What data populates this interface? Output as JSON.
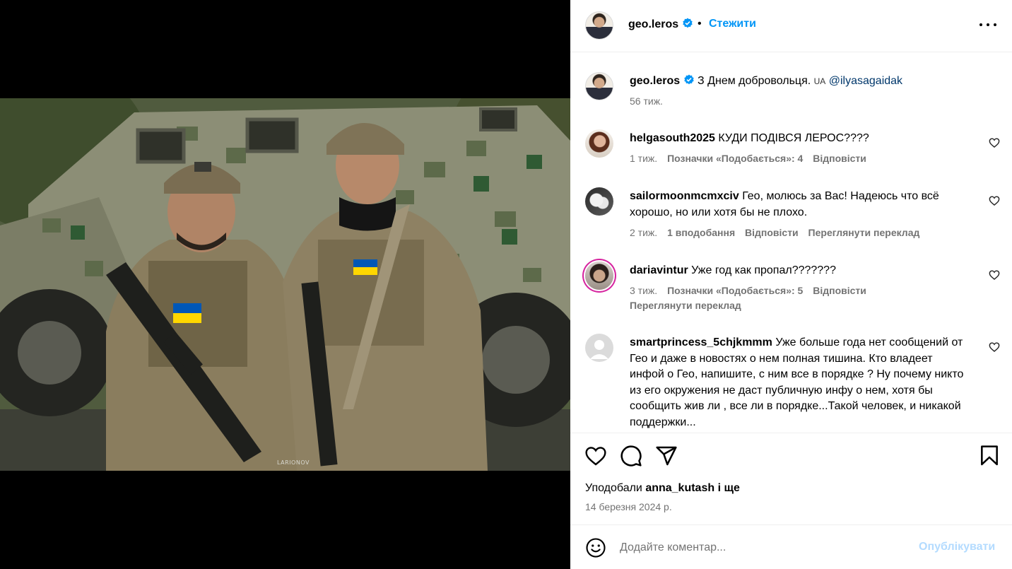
{
  "post": {
    "author": "geo.leros",
    "follow_label": "Стежити",
    "separator": "•",
    "caption_text": "З Днем добровольця. ",
    "caption_flag": "UA",
    "caption_mention": "@ilyasagaidak",
    "caption_time": "56 тиж.",
    "image_watermark": "LARIONOV"
  },
  "comments": [
    {
      "user": "helgasouth2025",
      "text": "КУДИ ПОДІВСЯ ЛЕРОС????",
      "time": "1 тиж.",
      "likes": "Позначки «Подобається»: 4",
      "reply": "Відповісти",
      "translate": ""
    },
    {
      "user": "sailormoonmcmxciv",
      "text": "Гео, молюсь за Вас! Надеюсь что всё хорошо, но или хотя бы не плохо.",
      "time": "2 тиж.",
      "likes": "1 вподобання",
      "reply": "Відповісти",
      "translate": "Переглянути переклад"
    },
    {
      "user": "dariavintur",
      "text": "Уже год как пропал???????",
      "time": "3 тиж.",
      "likes": "Позначки «Подобається»: 5",
      "reply": "Відповісти",
      "translate": "Переглянути переклад"
    },
    {
      "user": "smartprincess_5chjkmmm",
      "text": "Уже больше года нет сообщений от Гео и даже в новостях о нем полная тишина. Кто владеет инфой о Гео, напишите, с ним все в порядке ? Ну почему никто из его окружения не даст публичную инфу о нем, хотя бы сообщить жив ли , все ли в порядке...Такой человек, и никакой поддержки..."
    }
  ],
  "likes_line": {
    "prefix": "Уподобали ",
    "user": "anna_kutash",
    "suffix": " і ще"
  },
  "date": "14 березня 2024 р.",
  "comment_box": {
    "placeholder": "Додайте коментар...",
    "publish_label": "Опублікувати"
  },
  "icons": {
    "verified": "verified-badge-icon",
    "more": "more-options-icon",
    "like": "heart-icon",
    "comment": "comment-icon",
    "share": "share-icon",
    "save": "bookmark-icon",
    "emoji": "emoji-icon"
  },
  "colors": {
    "accent": "#0095f6",
    "verified": "#0095f6",
    "secondary_text": "#737373",
    "mention": "#00376b",
    "publish_disabled": "#b3dbff"
  }
}
